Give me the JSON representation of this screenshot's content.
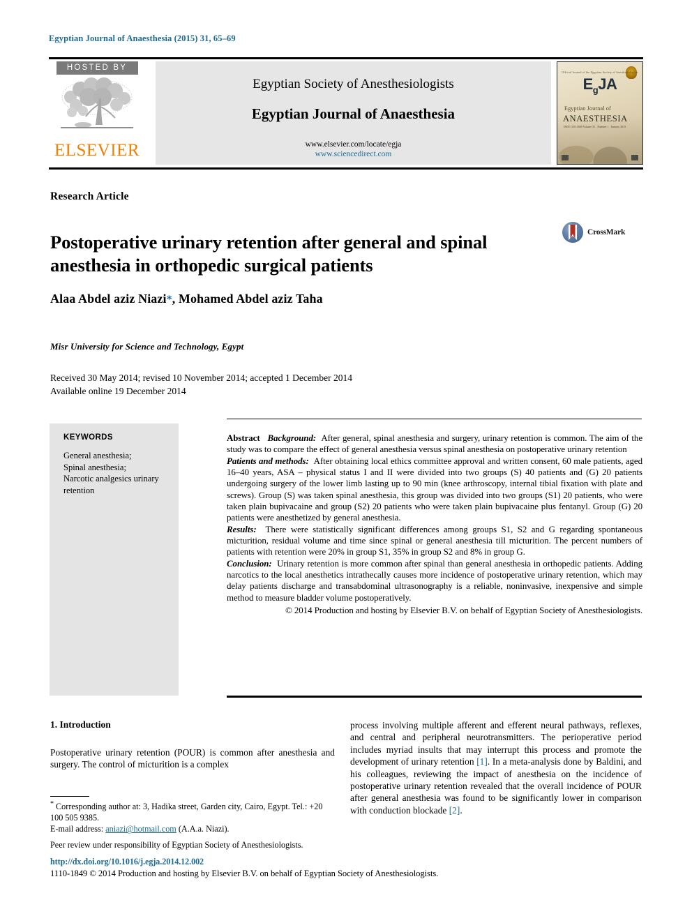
{
  "running_head": "Egyptian Journal of Anaesthesia (2015) 31, 65–69",
  "masthead": {
    "hosted_by": "HOSTED BY",
    "publisher": "ELSEVIER",
    "society": "Egyptian Society of Anesthesiologists",
    "journal": "Egyptian Journal of Anaesthesia",
    "url_locate": "www.elsevier.com/locate/egja",
    "url_sciencedirect": "www.sciencedirect.com",
    "cover": {
      "top_label": "Official Journal of the Egyptian Society of Anesthesiologists",
      "acronym": "EgJA",
      "acronym_sub": "g",
      "line1": "Egyptian Journal of",
      "line2": "ANAESTHESIA",
      "line3": "ISSN 1110-1849   Volume 31 · Number 1 · January 2015"
    }
  },
  "article": {
    "type": "Research Article",
    "title": "Postoperative urinary retention after general and spinal anesthesia in orthopedic surgical patients",
    "crossmark_label": "CrossMark",
    "authors": "Alaa Abdel aziz Niazi",
    "authors_rest": ", Mohamed Abdel aziz Taha",
    "corresponding_marker": "*",
    "affiliation": "Misr University for Science and Technology, Egypt",
    "received_line": "Received 30 May 2014; revised 10 November 2014; accepted 1 December 2014",
    "available_line": "Available online 19 December 2014"
  },
  "keywords": {
    "title": "KEYWORDS",
    "list": "General anesthesia; Spinal anesthesia; Narcotic analgesics urinary retention"
  },
  "abstract": {
    "label": "Abstract",
    "background_label": "Background:",
    "background_text": "After general, spinal anesthesia and surgery, urinary retention is common. The aim of the study was to compare the effect of general anesthesia versus spinal anesthesia on postoperative urinary retention",
    "methods_label": "Patients and methods:",
    "methods_text": "After obtaining local ethics committee approval and written consent, 60 male patients, aged 16–40 years, ASA – physical status I and II were divided into two groups (S) 40 patients and (G) 20 patients undergoing surgery of the lower limb lasting up to 90 min (knee arthroscopy, internal tibial fixation with plate and screws). Group (S) was taken spinal anesthesia, this group was divided into two groups (S1) 20 patients, who were taken plain bupivacaine and group (S2) 20 patients who were taken plain bupivacaine plus fentanyl. Group (G) 20 patients were anesthetized by general anesthesia.",
    "results_label": "Results:",
    "results_text": "There were statistically significant differences among groups S1, S2 and G regarding spontaneous micturition, residual volume and time since spinal or general anesthesia till micturition. The percent numbers of patients with retention were 20% in group S1, 35% in group S2 and 8% in group G.",
    "conclusion_label": "Conclusion:",
    "conclusion_text": "Urinary retention is more common after spinal than general anesthesia in orthopedic patients. Adding narcotics to the local anesthetics intrathecally causes more incidence of postoperative urinary retention, which may delay patients discharge and transabdominal ultrasonography is a reliable, noninvasive, inexpensive and simple method to measure bladder volume postoperatively.",
    "copyright": "© 2014 Production and hosting by Elsevier B.V. on behalf of Egyptian Society of Anesthesiologists."
  },
  "body": {
    "section_heading": "1. Introduction",
    "left_paragraph": "Postoperative urinary retention (POUR) is common after anesthesia and surgery. The control of micturition is a complex",
    "right_paragraph_a": "process involving multiple afferent and efferent neural pathways, reflexes, and central and peripheral neurotransmitters. The perioperative period includes myriad insults that may interrupt this process and promote the development of urinary retention ",
    "right_ref_1": "[1]",
    "right_paragraph_b": ". In a meta-analysis done by Baldini, and his colleagues, reviewing the impact of anesthesia on the incidence of postoperative urinary retention revealed that the overall incidence of POUR after general anesthesia was found to be significantly lower in comparison with conduction blockade ",
    "right_ref_2": "[2]",
    "right_paragraph_c": "."
  },
  "footnote": {
    "corresponding": "Corresponding author at: 3, Hadika street, Garden city, Cairo, Egypt. Tel.: +20 100 505 9385.",
    "email_label": "E-mail address: ",
    "email": "aniazi@hotmail.com",
    "email_suffix": " (A.A.a. Niazi).",
    "peer_review": "Peer review under responsibility of Egyptian Society of Anesthesiologists.",
    "doi": "http://dx.doi.org/10.1016/j.egja.2014.12.002",
    "issn_line": "1110-1849 © 2014 Production and hosting by Elsevier B.V. on behalf of Egyptian Society of Anesthesiologists."
  },
  "colors": {
    "link_blue": "#1c6a96",
    "elsevier_orange": "#f08000",
    "panel_gray": "#e6e6e6",
    "keyword_gray": "#e4e4e4"
  }
}
